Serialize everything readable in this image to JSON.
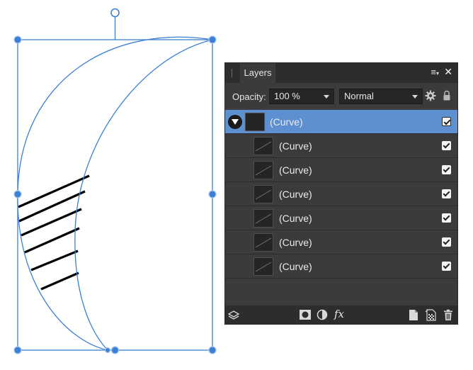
{
  "panel": {
    "tab_label": "Layers",
    "opacity_label": "Opacity:",
    "opacity_value": "100 %",
    "blend_mode": "Normal",
    "fx_label": "fx"
  },
  "layers": [
    {
      "name": "(Curve)",
      "level": "parent",
      "selected": true,
      "visible": true
    },
    {
      "name": "(Curve)",
      "level": "child",
      "selected": false,
      "visible": true
    },
    {
      "name": "(Curve)",
      "level": "child",
      "selected": false,
      "visible": true
    },
    {
      "name": "(Curve)",
      "level": "child",
      "selected": false,
      "visible": true
    },
    {
      "name": "(Curve)",
      "level": "child",
      "selected": false,
      "visible": true
    },
    {
      "name": "(Curve)",
      "level": "child",
      "selected": false,
      "visible": true
    },
    {
      "name": "(Curve)",
      "level": "child",
      "selected": false,
      "visible": true
    }
  ],
  "colors": {
    "selection": "#3c7fd6",
    "panel_bg": "#3b3b3b",
    "row_selected": "#5e8fd0"
  }
}
